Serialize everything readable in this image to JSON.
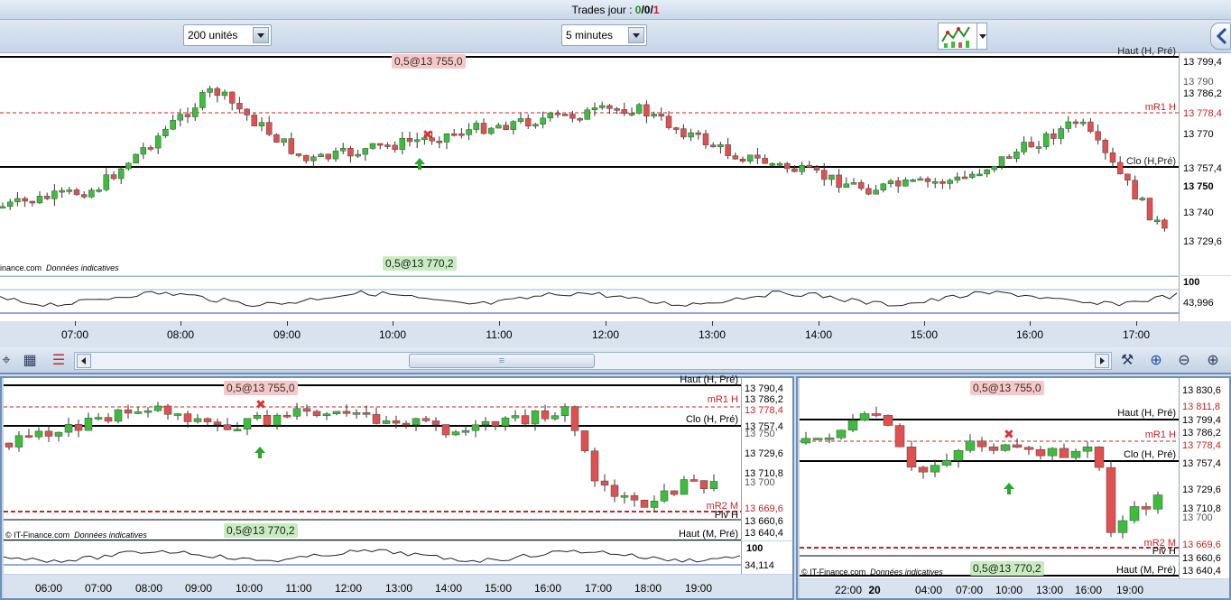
{
  "header": {
    "title_prefix": "Trades jour : ",
    "trades": [
      "0",
      "0",
      "1"
    ],
    "sep": "/",
    "colors": {
      "0": "#1a8f1a",
      "1": "#222222",
      "2": "#cc2222"
    }
  },
  "toolbar": {
    "units_select": "200 unités",
    "interval_select": "5 minutes",
    "indicator_button_icon": "chart-indicator-icon",
    "collapse_icon": "collapse-arrow-icon"
  },
  "main_chart": {
    "credit_text": "inance.com",
    "credit_note": "Données indicatives",
    "order_sell": "0,5@13 755,0",
    "order_buy": "0,5@13 770,2",
    "level_labels": {
      "haut": "Haut (H, Pré)",
      "mr1": "mR1 H",
      "clo": "Clo (H,Pré)"
    },
    "price_ticks": [
      "13 799,4",
      "13 790",
      "13 786,2",
      "13 778,4",
      "13 770",
      "13 757,4",
      "13 750",
      "13 740",
      "13 729,6"
    ],
    "oscillator_ticks": [
      "100",
      "43,996"
    ],
    "time_labels": [
      "07:00",
      "08:00",
      "09:00",
      "10:00",
      "11:00",
      "12:00",
      "13:00",
      "14:00",
      "15:00",
      "16:00",
      "17:00"
    ]
  },
  "scroll_toolbar": {
    "icons": [
      "cursor-icon",
      "grid-icon",
      "bars-icon"
    ],
    "right_icons": [
      "tools-icon",
      "zoom-fit-icon",
      "zoom-out-icon",
      "zoom-in-icon"
    ],
    "scroll_thumb": "≡"
  },
  "bottom_left_chart": {
    "credit_text": "© IT-Finance.com",
    "credit_note": "Données indicatives",
    "order_sell": "0,5@13 755,0",
    "order_buy": "0,5@13 770,2",
    "level_labels": {
      "haut": "Haut (H, Pré)",
      "mr1": "mR1 H",
      "clo": "Clo (H, Pré)",
      "mr2": "mR2 M",
      "piv": "Piv H",
      "hautm": "Haut (M, Pré)"
    },
    "price_ticks": [
      "13 790,4",
      "13 786,2",
      "13 778,4",
      "13 757,4",
      "13 750",
      "13 729,6",
      "13 710,8",
      "13 700",
      "13 669,6",
      "13 660,6",
      "13 640,4"
    ],
    "oscillator_ticks": [
      "100",
      "34,114"
    ],
    "time_labels": [
      "06:00",
      "07:00",
      "08:00",
      "09:00",
      "10:00",
      "11:00",
      "12:00",
      "13:00",
      "14:00",
      "15:00",
      "16:00",
      "17:00",
      "18:00",
      "19:00"
    ]
  },
  "bottom_right_chart": {
    "credit_text": "© IT-Finance.com",
    "credit_note": "Données indicatives",
    "order_sell": "0,5@13 755,0",
    "order_buy": "0,5@13 770,2",
    "level_labels": {
      "haut": "Haut (H, Pré)",
      "mr1": "mR1 H",
      "clo": "Clo (H, Pré)",
      "mr2": "mR2 M",
      "piv": "Piv H",
      "hautm": "Haut (M, Pré)"
    },
    "price_ticks": [
      "13 830,6",
      "13 811,8",
      "13 799,4",
      "13 786,2",
      "13 778,4",
      "13 757,4",
      "13 729,6",
      "13 710,8",
      "13 700",
      "13 669,6",
      "13 660,6",
      "13 640,4"
    ],
    "time_labels": [
      "22:00",
      "20",
      "04:00",
      "07:00",
      "10:00",
      "13:00",
      "16:00",
      "19:00"
    ]
  },
  "colors": {
    "bull": "#3bbf3b",
    "bear": "#e05050",
    "resistance": "#cc2222",
    "frame": "#9fb3cc"
  }
}
